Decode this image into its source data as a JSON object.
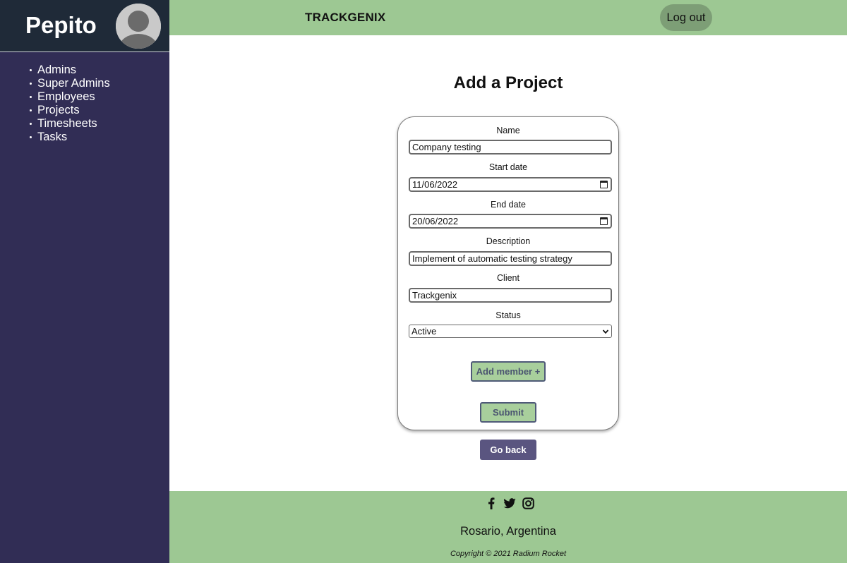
{
  "sidebar": {
    "user_name": "Pepito",
    "items": [
      {
        "label": "Admins"
      },
      {
        "label": "Super Admins"
      },
      {
        "label": "Employees"
      },
      {
        "label": "Projects"
      },
      {
        "label": "Timesheets"
      },
      {
        "label": "Tasks"
      }
    ]
  },
  "header": {
    "brand": "TRACKGENIX",
    "logout_label": "Log out"
  },
  "main": {
    "title": "Add a Project",
    "form": {
      "name_label": "Name",
      "name_value": "Company testing",
      "start_label": "Start date",
      "start_value": "11/06/2022",
      "end_label": "End date",
      "end_value": "20/06/2022",
      "description_label": "Description",
      "description_value": "Implement of automatic testing strategy",
      "client_label": "Client",
      "client_value": "Trackgenix",
      "status_label": "Status",
      "status_value": "Active",
      "add_member_label": "Add member +",
      "submit_label": "Submit"
    },
    "go_back_label": "Go back"
  },
  "footer": {
    "icons": [
      "facebook-icon",
      "twitter-icon",
      "instagram-icon"
    ],
    "location": "Rosario, Argentina",
    "copyright": "Copyright © 2021 Radium Rocket"
  },
  "colors": {
    "sidebar_bg": "#312d55",
    "sidebar_header_bg": "#1f2a38",
    "topbar_bg": "#9dc893",
    "button_green": "#a8cf9c",
    "go_back_bg": "#5a5580"
  }
}
